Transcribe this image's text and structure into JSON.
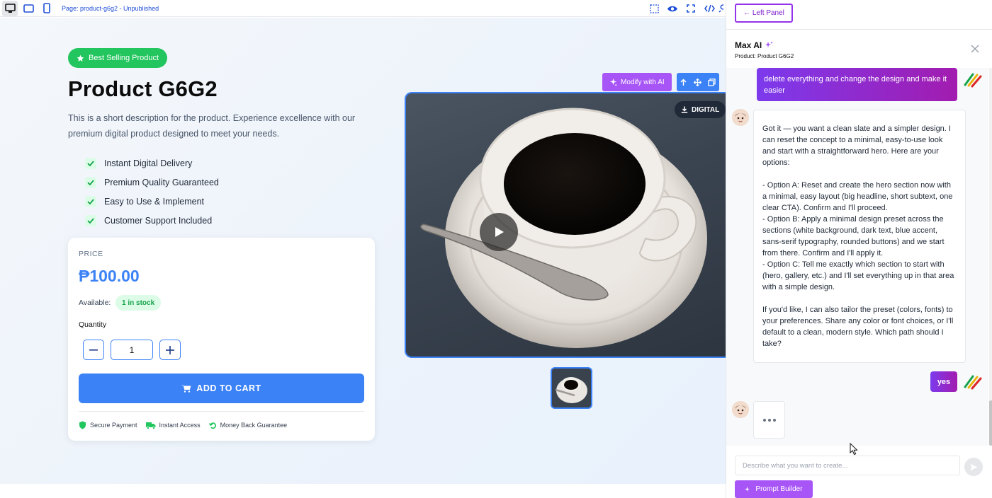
{
  "toolbar": {
    "page_label": "Page: product-g6g2 - Unpublished",
    "devices": [
      "desktop-icon",
      "tablet-icon",
      "mobile-icon"
    ],
    "right_icons": [
      "select-area-icon",
      "eye-icon",
      "fullscreen-icon",
      "code-icon",
      "undo-icon"
    ]
  },
  "product": {
    "badge": "Best Selling Product",
    "title": "Product G6G2",
    "description": "This is a short description for the product. Experience excellence with our premium digital product designed to meet your needs.",
    "features": [
      "Instant Digital Delivery",
      "Premium Quality Guaranteed",
      "Easy to Use & Implement",
      "Customer Support Included"
    ],
    "price_label": "PRICE",
    "price": "₱100.00",
    "available_label": "Available:",
    "stock": "1 in stock",
    "quantity_label": "Quantity",
    "quantity_value": "1",
    "add_to_cart": "ADD TO CART",
    "trust": [
      "Secure Payment",
      "Instant Access",
      "Money Back Guarantee"
    ],
    "digital_badge": "DIGITAL",
    "modify_ai": "Modify with AI"
  },
  "panel": {
    "left_panel_btn": "← Left Panel",
    "title": "Max AI",
    "subtitle": "Product: Product G6G2",
    "messages": {
      "user1": "delete everything and change the design and make it easier",
      "bot1": "Got it — you want a clean slate and a simpler design. I can reset the concept to a minimal, easy-to-use look and start with a straightforward hero. Here are your options:\n\n- Option A: Reset and create the hero section now with a minimal, easy layout (big headline, short subtext, one clear CTA). Confirm and I'll proceed.\n- Option B: Apply a minimal design preset across the sections (white background, dark text, blue accent, sans-serif typography, rounded buttons) and we start from there. Confirm and I'll apply it.\n- Option C: Tell me exactly which section to start with (hero, gallery, etc.) and I'll set everything up in that area with a simple design.\n\nIf you'd like, I can also tailor the preset (colors, fonts) to your preferences. Share any color or font choices, or I'll default to a clean, modern style. Which path should I take?",
      "user2": "yes"
    },
    "input_placeholder": "Describe what you want to create...",
    "prompt_builder": "Prompt Builder"
  },
  "colors": {
    "accent_blue": "#3b82f6",
    "success_green": "#22c55e",
    "ai_purple": "#a855f7"
  }
}
